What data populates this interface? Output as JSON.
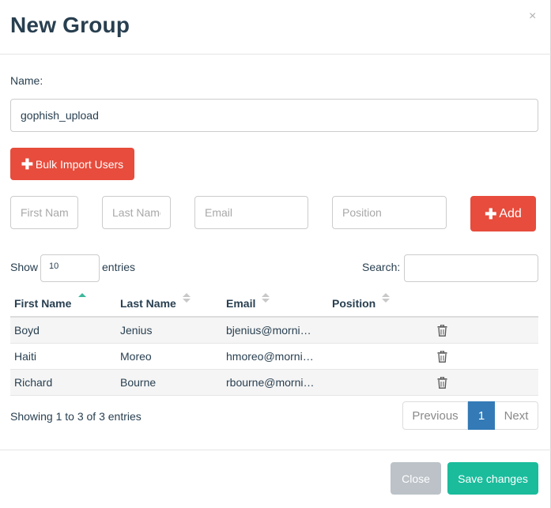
{
  "modal": {
    "title": "New Group",
    "close_glyph": "×"
  },
  "form": {
    "name_label": "Name:",
    "name_value": "gophish_upload",
    "bulk_import_label": "Bulk Import Users",
    "add_label": "Add",
    "first_name_placeholder": "First Name",
    "last_name_placeholder": "Last Name",
    "email_placeholder": "Email",
    "position_placeholder": "Position"
  },
  "table_controls": {
    "show_label": "Show",
    "page_length": "10",
    "entries_label": "entries",
    "search_label": "Search:",
    "search_value": ""
  },
  "table": {
    "columns": [
      "First Name",
      "Last Name",
      "Email",
      "Position"
    ],
    "sorted_column": "First Name",
    "rows": [
      {
        "first": "Boyd",
        "last": "Jenius",
        "email": "bjenius@morni…",
        "position": ""
      },
      {
        "first": "Haiti",
        "last": "Moreo",
        "email": "hmoreo@morni…",
        "position": ""
      },
      {
        "first": "Richard",
        "last": "Bourne",
        "email": "rbourne@morni…",
        "position": ""
      }
    ]
  },
  "pagination": {
    "info": "Showing 1 to 3 of 3 entries",
    "previous": "Previous",
    "current_page": "1",
    "next": "Next"
  },
  "footer": {
    "close_label": "Close",
    "save_label": "Save changes"
  },
  "colors": {
    "danger": "#e74c3c",
    "primary": "#337ab7",
    "success": "#1abc9c",
    "disabled": "#bcc2c8",
    "sort_active": "#3cb89b"
  },
  "icons": {
    "plus": "plus-icon",
    "trash": "trash-icon",
    "sort": "sort-icon",
    "close": "close-icon"
  }
}
